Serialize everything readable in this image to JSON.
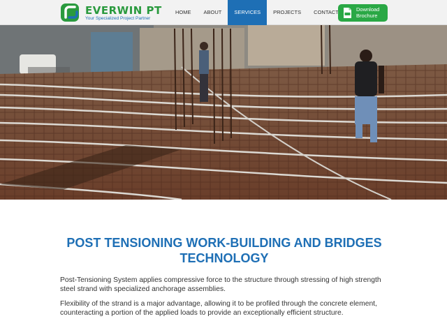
{
  "brand": {
    "name": "EVERWIN PT",
    "tagline": "Your Specialized Project Partner",
    "colors": {
      "green": "#2a9a3e",
      "blue": "#1e6fb5"
    }
  },
  "nav": {
    "items": [
      "HOME",
      "ABOUT",
      "SERVICES",
      "PROJECTS",
      "CONTACT"
    ],
    "active": "SERVICES"
  },
  "brochure": {
    "label": "Download Brochure",
    "icon": "pdf-icon"
  },
  "hero": {
    "icon": "construction-site-photo"
  },
  "content": {
    "title": "POST TENSIONING WORK-BUILDING AND BRIDGES TECHNOLOGY",
    "paragraphs": [
      "Post-Tensioning System applies compressive force to the structure through stressing of high strength steel strand with specialized anchorage assemblies.",
      "Flexibility of the strand is a major advantage, allowing it to be profiled through the concrete element, counteracting a portion of the applied loads to provide an exceptionally efficient structure."
    ]
  }
}
